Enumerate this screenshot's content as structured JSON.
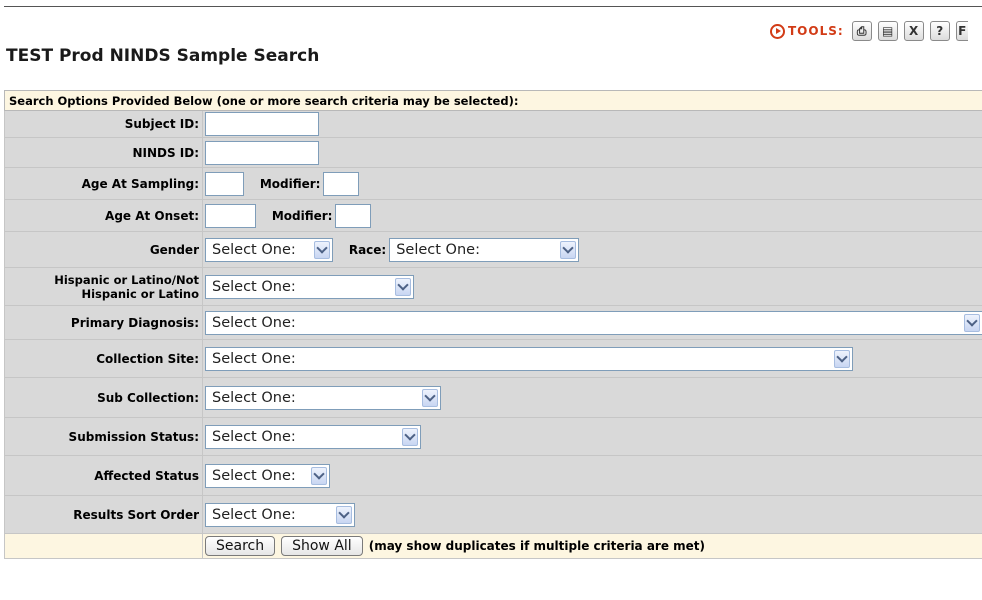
{
  "toolbar": {
    "tools_label": "TOOLS:",
    "buttons": [
      {
        "icon": "print-icon",
        "glyph": "⎙"
      },
      {
        "icon": "export-icon",
        "glyph": "▤"
      },
      {
        "icon": "excel-icon",
        "glyph": "X"
      },
      {
        "icon": "help-icon",
        "glyph": "?"
      },
      {
        "icon": "f-icon",
        "glyph": "F"
      }
    ]
  },
  "page": {
    "title": "TEST Prod NINDS Sample Search"
  },
  "form": {
    "header": "Search Options Provided Below (one or more search criteria may be selected):",
    "subject_id": {
      "label": "Subject ID:",
      "value": ""
    },
    "ninds_id": {
      "label": "NINDS ID:",
      "value": ""
    },
    "age_sampling": {
      "label": "Age At Sampling:",
      "value": "",
      "modifier_label": "Modifier:",
      "modifier_value": ""
    },
    "age_onset": {
      "label": "Age At Onset:",
      "value": "",
      "modifier_label": "Modifier:",
      "modifier_value": ""
    },
    "gender": {
      "label": "Gender",
      "selected": "Select One:",
      "race_label": "Race:",
      "race_selected": "Select One:"
    },
    "hispanic": {
      "label_line1": "Hispanic or Latino/Not",
      "label_line2": "Hispanic or Latino",
      "selected": "Select One:"
    },
    "primary_diagnosis": {
      "label": "Primary Diagnosis:",
      "selected": "Select One:"
    },
    "collection_site": {
      "label": "Collection Site:",
      "selected": "Select One:"
    },
    "sub_collection": {
      "label": "Sub Collection:",
      "selected": "Select One:"
    },
    "submission_status": {
      "label": "Submission Status:",
      "selected": "Select One:"
    },
    "affected_status": {
      "label": "Affected Status",
      "selected": "Select One:"
    },
    "results_sort_order": {
      "label": "Results Sort Order",
      "selected": "Select One:"
    },
    "search_button": "Search",
    "show_all_button": "Show All",
    "note": "(may show duplicates if multiple criteria are met)"
  },
  "colors": {
    "accent": "#d23b16",
    "row_bg": "#d9d9d9",
    "header_bg": "#fdf6e1"
  }
}
